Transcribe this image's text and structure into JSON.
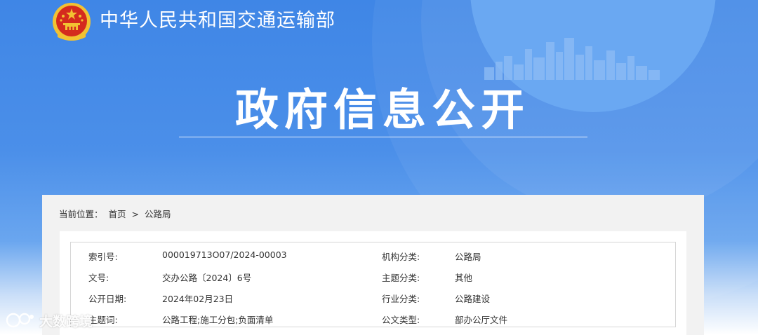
{
  "header": {
    "ministry_name": "中华人民共和国交通运输部",
    "page_title": "政府信息公开"
  },
  "breadcrumb": {
    "label": "当前位置：",
    "home": "首页",
    "separator": ">",
    "current": "公路局"
  },
  "metadata": {
    "rows": [
      {
        "label1": "索引号:",
        "value1": "000019713O07/2024-00003",
        "label2": "机构分类:",
        "value2": "公路局"
      },
      {
        "label1": "文号:",
        "value1": "交办公路〔2024〕6号",
        "label2": "主题分类:",
        "value2": "其他"
      },
      {
        "label1": "公开日期:",
        "value1": "2024年02月23日",
        "label2": "行业分类:",
        "value2": "公路建设"
      },
      {
        "label1": "主题词:",
        "value1": "公路工程;施工分包;负面清单",
        "label2": "公文类型:",
        "value2": "部办公厅文件"
      }
    ]
  },
  "watermark": {
    "text": "大数跨境"
  },
  "colors": {
    "banner_blue": "#3f86e6",
    "emblem_red": "#d42a1e",
    "emblem_gold": "#f2c232",
    "panel_gray": "#f2f2f2",
    "text_dark": "#333333"
  }
}
